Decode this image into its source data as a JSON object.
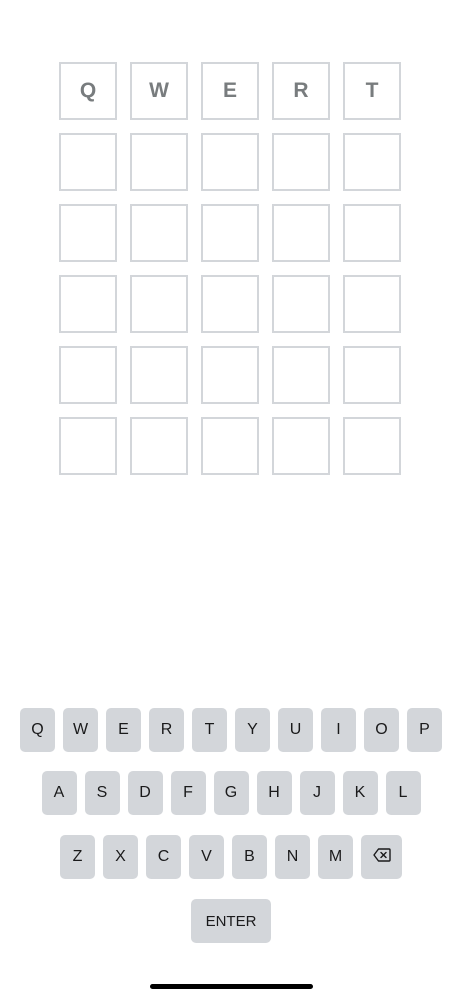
{
  "board": {
    "rows": [
      [
        "Q",
        "W",
        "E",
        "R",
        "T"
      ],
      [
        "",
        "",
        "",
        "",
        ""
      ],
      [
        "",
        "",
        "",
        "",
        ""
      ],
      [
        "",
        "",
        "",
        "",
        ""
      ],
      [
        "",
        "",
        "",
        "",
        ""
      ],
      [
        "",
        "",
        "",
        "",
        ""
      ]
    ]
  },
  "keyboard": {
    "row1": [
      "Q",
      "W",
      "E",
      "R",
      "T",
      "Y",
      "U",
      "I",
      "O",
      "P"
    ],
    "row2": [
      "A",
      "S",
      "D",
      "F",
      "G",
      "H",
      "J",
      "K",
      "L"
    ],
    "row3": [
      "Z",
      "X",
      "C",
      "V",
      "B",
      "N",
      "M"
    ],
    "backspace_icon": "backspace-icon",
    "enter_label": "ENTER"
  },
  "colors": {
    "tile_border": "#d3d6da",
    "tile_letter": "#787c7e",
    "key_background": "#d3d6da",
    "key_text": "#1a1a1b"
  }
}
